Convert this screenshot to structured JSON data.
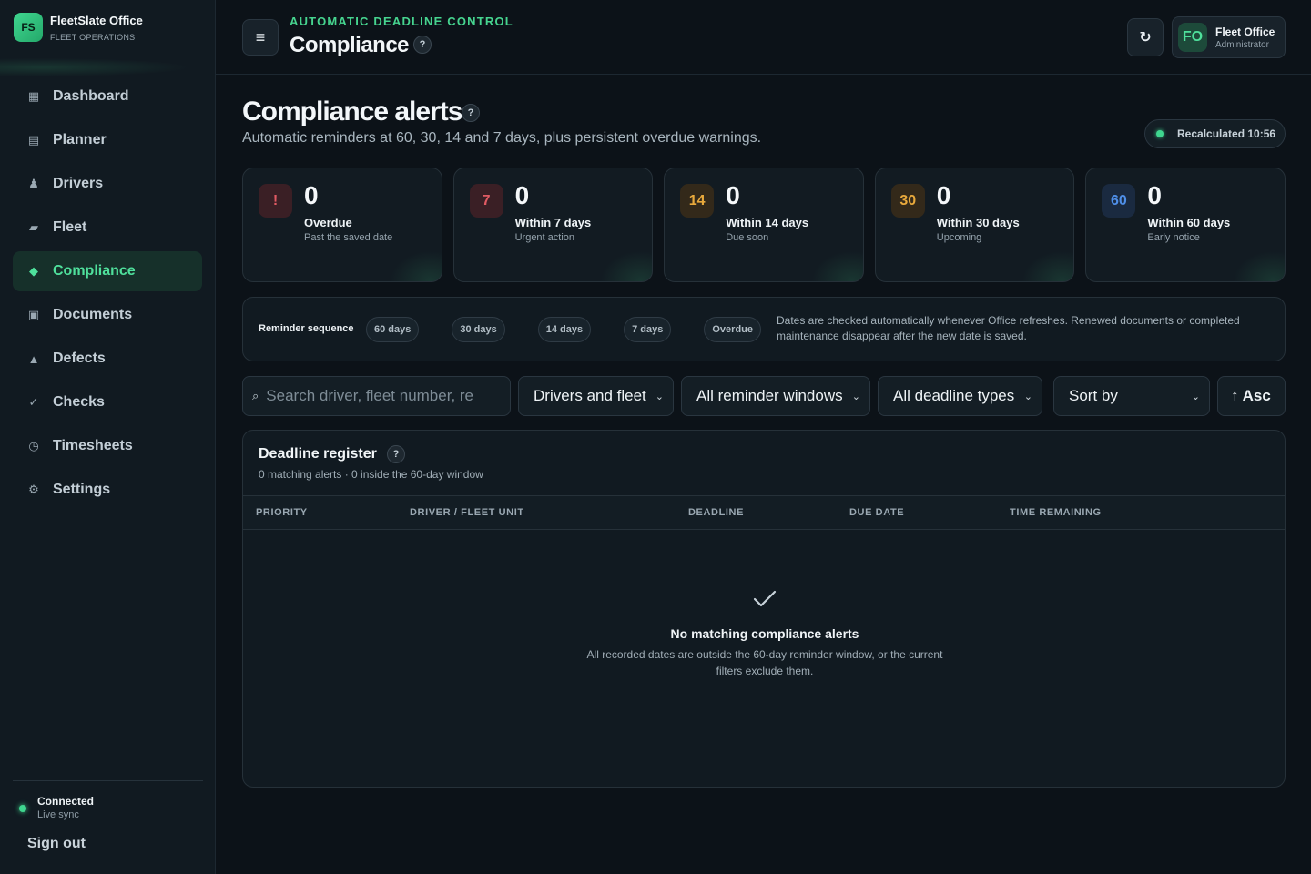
{
  "brand": {
    "logo": "FS",
    "name": "FleetSlate Office",
    "subtitle": "FLEET OPERATIONS"
  },
  "nav": [
    {
      "label": "Dashboard",
      "icon": "grid-icon",
      "glyph": "▦",
      "active": false
    },
    {
      "label": "Planner",
      "icon": "planner-icon",
      "glyph": "▤",
      "active": false
    },
    {
      "label": "Drivers",
      "icon": "driver-icon",
      "glyph": "♟",
      "active": false
    },
    {
      "label": "Fleet",
      "icon": "truck-icon",
      "glyph": "▰",
      "active": false
    },
    {
      "label": "Compliance",
      "icon": "diamond-icon",
      "glyph": "◆",
      "active": true
    },
    {
      "label": "Documents",
      "icon": "document-icon",
      "glyph": "▣",
      "active": false
    },
    {
      "label": "Defects",
      "icon": "warning-icon",
      "glyph": "▲",
      "active": false
    },
    {
      "label": "Checks",
      "icon": "check-icon",
      "glyph": "✓",
      "active": false
    },
    {
      "label": "Timesheets",
      "icon": "clock-icon",
      "glyph": "◷",
      "active": false
    },
    {
      "label": "Settings",
      "icon": "gear-icon",
      "glyph": "⚙",
      "active": false
    }
  ],
  "connection": {
    "title": "Connected",
    "subtitle": "Live sync"
  },
  "sign_out": "Sign out",
  "header": {
    "eyebrow": "AUTOMATIC DEADLINE CONTROL",
    "title": "Compliance",
    "help": "?",
    "menu_glyph": "≡",
    "refresh_glyph": "↻",
    "user": {
      "initials": "FO",
      "name": "Fleet Office",
      "role": "Administrator"
    }
  },
  "section": {
    "title": "Compliance alerts",
    "help": "?",
    "subtitle": "Automatic reminders at 60, 30, 14 and 7 days, plus persistent overdue warnings.",
    "recalculated": "Recalculated 10:56"
  },
  "stats": [
    {
      "badge": "!",
      "value": "0",
      "label": "Overdue",
      "hint": "Past the saved date",
      "color": "#e05a63",
      "bg": "#3a1f25"
    },
    {
      "badge": "7",
      "value": "0",
      "label": "Within 7 days",
      "hint": "Urgent action",
      "color": "#e05a63",
      "bg": "#3a1f25"
    },
    {
      "badge": "14",
      "value": "0",
      "label": "Within 14 days",
      "hint": "Due soon",
      "color": "#e8a93c",
      "bg": "#33291a"
    },
    {
      "badge": "30",
      "value": "0",
      "label": "Within 30 days",
      "hint": "Upcoming",
      "color": "#e8a93c",
      "bg": "#33291a"
    },
    {
      "badge": "60",
      "value": "0",
      "label": "Within 60 days",
      "hint": "Early notice",
      "color": "#4f8fe8",
      "bg": "#1a2a40"
    }
  ],
  "sequence": {
    "title": "Reminder sequence",
    "steps": [
      "60 days",
      "30 days",
      "14 days",
      "7 days",
      "Overdue"
    ],
    "note": "Dates are checked automatically whenever Office refreshes. Renewed documents or completed maintenance disappear after the new date is saved."
  },
  "filters": {
    "search_placeholder": "Search driver, fleet number, re",
    "search_glyph": "⌕",
    "scope": "Drivers and fleet",
    "window": "All reminder windows",
    "type": "All deadline types",
    "sort": "Sort by",
    "order": "↑ Asc"
  },
  "register": {
    "title": "Deadline register",
    "help": "?",
    "subtitle": "0 matching alerts · 0 inside the 60-day window",
    "columns": [
      "PRIORITY",
      "DRIVER / FLEET UNIT",
      "DEADLINE",
      "DUE DATE",
      "TIME REMAINING"
    ],
    "empty_title": "No matching compliance alerts",
    "empty_text": "All recorded dates are outside the 60-day reminder window, or the current filters exclude them."
  }
}
